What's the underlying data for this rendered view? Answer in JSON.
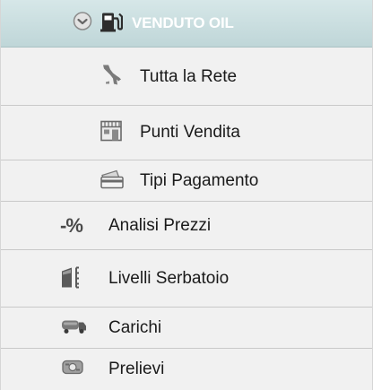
{
  "menu": {
    "header": {
      "label": "VENDUTO OIL",
      "expanded": true,
      "icons": [
        "chevron-circle-down-icon",
        "fuel-pump-icon"
      ]
    },
    "subitems": [
      {
        "label": "Tutta la Rete",
        "icon": "italy-map-icon"
      },
      {
        "label": "Punti Vendita",
        "icon": "store-front-icon"
      },
      {
        "label": "Tipi Pagamento",
        "icon": "credit-card-icon"
      }
    ],
    "items": [
      {
        "label": "Analisi Prezzi",
        "icon": "percent-minus-icon"
      },
      {
        "label": "Livelli Serbatoio",
        "icon": "tank-level-icon"
      },
      {
        "label": "Carichi",
        "icon": "tanker-truck-icon"
      },
      {
        "label": "Prelievi",
        "icon": "withdrawal-icon"
      }
    ],
    "colors": {
      "header_bg": "#c8dcde",
      "header_text": "#ffffff",
      "row_bg": "#f1f1f1",
      "separator": "#c9c9c9"
    }
  }
}
